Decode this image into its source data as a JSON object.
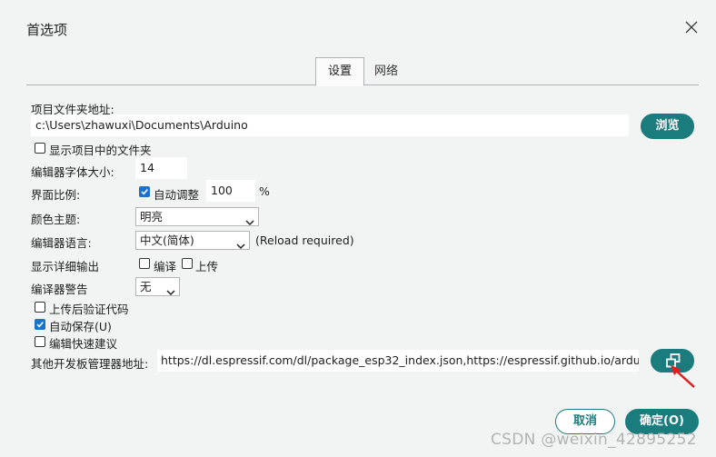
{
  "dialog": {
    "title": "首选项"
  },
  "tabs": [
    {
      "label": "设置"
    },
    {
      "label": "网络"
    }
  ],
  "sketchbook": {
    "label": "项目文件夹地址:",
    "value": "c:\\Users\\zhawuxi\\Documents\\Arduino",
    "browse_label": "浏览"
  },
  "show_files": {
    "label": "显示项目中的文件夹",
    "checked": false
  },
  "font_size": {
    "label": "编辑器字体大小:",
    "value": "14"
  },
  "scale": {
    "label": "界面比例:",
    "auto_label": "自动调整",
    "auto_checked": true,
    "value": "100",
    "unit": "%"
  },
  "theme": {
    "label": "颜色主题:",
    "value": "明亮"
  },
  "language": {
    "label": "编辑器语言:",
    "value": "中文(简体)",
    "note": "(Reload required)"
  },
  "verbose": {
    "label": "显示详细输出",
    "compile_label": "编译",
    "upload_label": "上传"
  },
  "warnings": {
    "label": "编译器警告",
    "value": "无"
  },
  "verify_upload": {
    "label": "上传后验证代码",
    "checked": false
  },
  "autosave": {
    "label": "自动保存(U)",
    "checked": true
  },
  "quick_suggest": {
    "label": "编辑快速建议",
    "checked": false
  },
  "board_urls": {
    "label": "其他开发板管理器地址:",
    "value": "https://dl.espressif.com/dl/package_esp32_index.json,https://espressif.github.io/arduino-..."
  },
  "footer": {
    "cancel_label": "取消",
    "ok_label": "确定(O)"
  },
  "watermark": "CSDN @weixin_42895252",
  "colors": {
    "accent": "#1a7c7d",
    "checkbox": "#1a73c9",
    "annotation_arrow": "#e02020"
  }
}
